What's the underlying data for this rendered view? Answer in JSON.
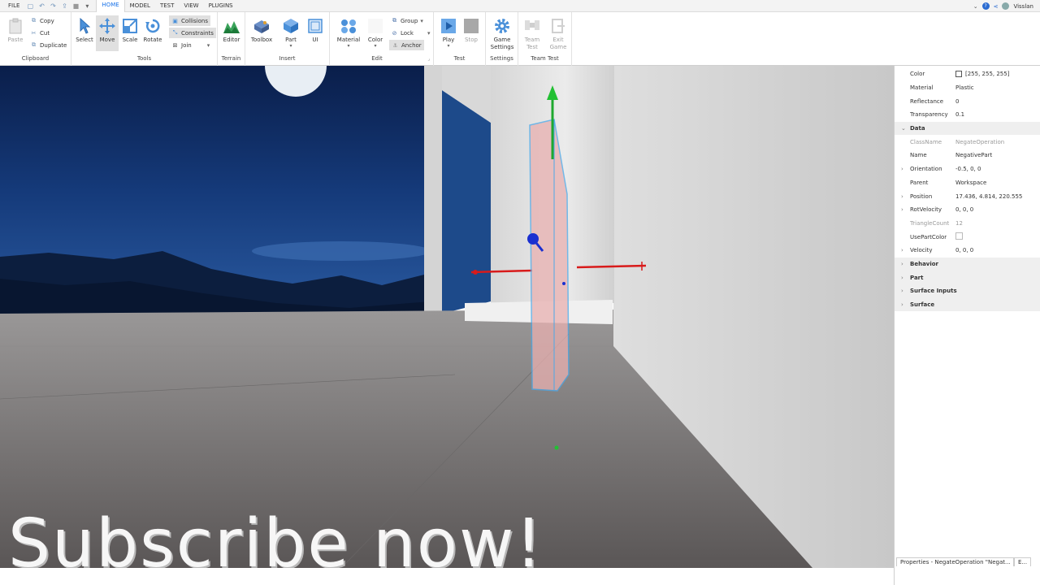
{
  "menubar": {
    "file": "FILE",
    "tabs": [
      "HOME",
      "MODEL",
      "TEST",
      "VIEW",
      "PLUGINS"
    ],
    "username": "Visslan"
  },
  "ribbon": {
    "clipboard": {
      "paste": "Paste",
      "copy": "Copy",
      "cut": "Cut",
      "duplicate": "Duplicate",
      "label": "Clipboard"
    },
    "tools": {
      "select": "Select",
      "move": "Move",
      "scale": "Scale",
      "rotate": "Rotate",
      "collisions": "Collisions",
      "constraints": "Constraints",
      "join": "Join",
      "label": "Tools"
    },
    "terrain": {
      "editor": "Editor",
      "label": "Terrain"
    },
    "insert": {
      "toolbox": "Toolbox",
      "part": "Part",
      "ui": "UI",
      "label": "Insert"
    },
    "edit": {
      "material": "Material",
      "color": "Color",
      "group": "Group",
      "lock": "Lock",
      "anchor": "Anchor",
      "label": "Edit"
    },
    "test": {
      "play": "Play",
      "stop": "Stop",
      "label": "Test"
    },
    "settings": {
      "game_settings": "Game Settings",
      "label": "Settings"
    },
    "team_test": {
      "team_test": "Team Test",
      "exit_game": "Exit Game",
      "label": "Team Test"
    }
  },
  "viewport": {
    "overlay_text": "Subscribe now!"
  },
  "properties": {
    "rows": [
      {
        "name": "Color",
        "value": "[255, 255, 255]",
        "kind": "color"
      },
      {
        "name": "Material",
        "value": "Plastic"
      },
      {
        "name": "Reflectance",
        "value": "0"
      },
      {
        "name": "Transparency",
        "value": "0.1"
      },
      {
        "name": "Data",
        "kind": "category",
        "expanded": true
      },
      {
        "name": "ClassName",
        "value": "NegateOperation",
        "readonly": true
      },
      {
        "name": "Name",
        "value": "NegativePart"
      },
      {
        "name": "Orientation",
        "value": "-0.5, 0, 0",
        "expandable": true
      },
      {
        "name": "Parent",
        "value": "Workspace"
      },
      {
        "name": "Position",
        "value": "17.436, 4.814, 220.555",
        "expandable": true
      },
      {
        "name": "RotVelocity",
        "value": "0, 0, 0",
        "expandable": true
      },
      {
        "name": "TriangleCount",
        "value": "12",
        "readonly": true
      },
      {
        "name": "UsePartColor",
        "value": "",
        "kind": "checkbox"
      },
      {
        "name": "Velocity",
        "value": "0, 0, 0",
        "expandable": true
      },
      {
        "name": "Behavior",
        "kind": "category"
      },
      {
        "name": "Part",
        "kind": "category"
      },
      {
        "name": "Surface Inputs",
        "kind": "category"
      },
      {
        "name": "Surface",
        "kind": "category"
      }
    ],
    "tab_active": "Properties - NegateOperation \"Negat...",
    "tab_other": "E..."
  }
}
